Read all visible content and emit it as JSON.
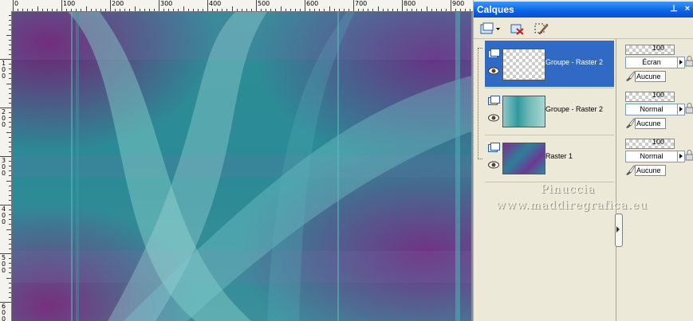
{
  "canvas": {
    "ruler_top_labels": [
      "0",
      "100",
      "200",
      "300",
      "400",
      "500",
      "600",
      "700",
      "800",
      "900"
    ],
    "ruler_left_labels": [
      "1\n0\n0",
      "2\n0\n0",
      "3\n0\n0",
      "4\n0\n0",
      "5\n0\n0",
      "6\n0\n0"
    ]
  },
  "palette": {
    "title": "Calques",
    "layers": [
      {
        "name": "Groupe - Raster 2",
        "selected": true,
        "opacity": "100",
        "blend": "Écran",
        "mask": "Aucune",
        "thumb": "transparent"
      },
      {
        "name": "Groupe - Raster 2",
        "selected": false,
        "opacity": "100",
        "blend": "Normal",
        "mask": "Aucune",
        "thumb": "teal"
      },
      {
        "name": "Raster 1",
        "selected": false,
        "opacity": "100",
        "blend": "Normal",
        "mask": "Aucune",
        "thumb": "purple"
      }
    ]
  },
  "watermark": {
    "line1": "Pinuccia",
    "line2": "www.maddiregrafica.eu"
  },
  "colors": {
    "title_bar": "#0a62e3",
    "selection": "#316ac5",
    "panel_bg": "#ece9d8"
  }
}
